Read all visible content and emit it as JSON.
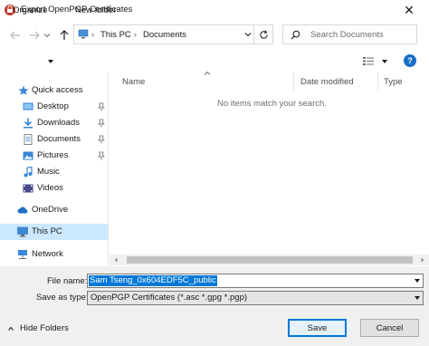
{
  "window": {
    "title": "Export OpenPGP Certificates",
    "close_glyph": "✕"
  },
  "nav": {
    "back_icon": "arrow-left-icon",
    "forward_icon": "arrow-right-icon",
    "recent_icon": "chevron-down-icon",
    "up_icon": "arrow-up-icon"
  },
  "address": {
    "segments": [
      "This PC",
      "Documents"
    ],
    "separator": "›"
  },
  "search": {
    "placeholder": "Search Documents"
  },
  "toolbar": {
    "organize_label": "Organize",
    "new_folder_label": "New folder",
    "help_label": "?"
  },
  "sidebar": {
    "items": [
      {
        "label": "Quick access",
        "icon": "star-icon"
      },
      {
        "label": "Desktop",
        "icon": "desktop-folder-icon",
        "pinned": true
      },
      {
        "label": "Downloads",
        "icon": "downloads-icon",
        "pinned": true
      },
      {
        "label": "Documents",
        "icon": "documents-icon",
        "pinned": true
      },
      {
        "label": "Pictures",
        "icon": "pictures-icon",
        "pinned": true
      },
      {
        "label": "Music",
        "icon": "music-icon"
      },
      {
        "label": "Videos",
        "icon": "videos-icon"
      },
      {
        "label": "OneDrive",
        "icon": "cloud-icon"
      },
      {
        "label": "This PC",
        "icon": "computer-icon",
        "selected": true
      },
      {
        "label": "Network",
        "icon": "network-icon"
      }
    ]
  },
  "columns": {
    "name": "Name",
    "date_modified": "Date modified",
    "type": "Type"
  },
  "empty_message": "No items match your search.",
  "form": {
    "file_name_label": "File name:",
    "file_name_value": "Sam Tseng_0x604EDF5C_public",
    "save_as_type_label": "Save as type:",
    "save_as_type_value": "OpenPGP Certificates (*.asc *.gpg *.pgp)"
  },
  "footer": {
    "hide_folders_label": "Hide Folders",
    "save_label": "Save",
    "cancel_label": "Cancel"
  },
  "colors": {
    "accent": "#0078d7",
    "selection": "#cce8ff",
    "bottom_bg": "#f0f0f0"
  }
}
